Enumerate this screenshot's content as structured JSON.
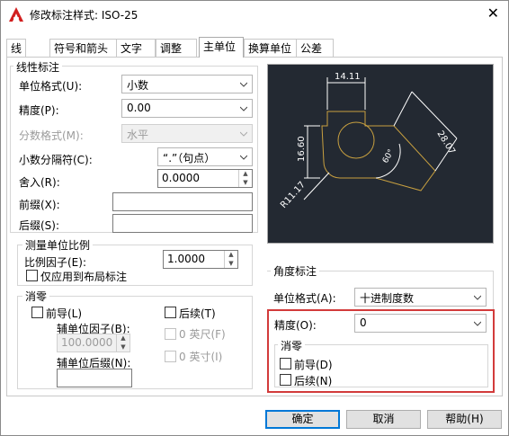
{
  "window": {
    "title": "修改标注样式: ISO-25",
    "close_glyph": "✕"
  },
  "tabs": [
    "线",
    "符号和箭头",
    "文字",
    "调整",
    "主单位",
    "换算单位",
    "公差"
  ],
  "active_tab": "主单位",
  "linear": {
    "group_label": "线性标注",
    "unit_format_label": "单位格式(U):",
    "unit_format_value": "小数",
    "precision_label": "精度(P):",
    "precision_value": "0.00",
    "fraction_format_label": "分数格式(M):",
    "fraction_format_value": "水平",
    "decimal_separator_label": "小数分隔符(C):",
    "decimal_separator_value": "“.”（句点）",
    "round_off_label": "舍入(R):",
    "round_off_value": "0.0000",
    "prefix_label": "前缀(X):",
    "prefix_value": "",
    "suffix_label": "后缀(S):",
    "suffix_value": ""
  },
  "scale": {
    "group_label": "测量单位比例",
    "scale_factor_label": "比例因子(E):",
    "scale_factor_value": "1.0000",
    "layout_only_label": "仅应用到布局标注"
  },
  "zero_suppression": {
    "group_label": "消零",
    "leading_label": "前导(L)",
    "sub_unit_factor_label": "辅单位因子(B):",
    "sub_unit_factor_value": "100.0000",
    "sub_unit_suffix_label": "辅单位后缀(N):",
    "sub_unit_suffix_value": "",
    "trailing_label": "后续(T)",
    "feet_label": "0 英尺(F)",
    "inches_label": "0 英寸(I)"
  },
  "preview": {
    "dim_top": "14.11",
    "dim_left": "16.60",
    "dim_right": "28.07",
    "dim_angle": "60°",
    "dim_radius": "R11.17",
    "line_color": "#c8a040",
    "text_color": "#ffffff"
  },
  "angular": {
    "group_label": "角度标注",
    "unit_format_label": "单位格式(A):",
    "unit_format_value": "十进制度数",
    "precision_label": "精度(O):",
    "precision_value": "0",
    "zero_group_label": "消零",
    "leading_label": "前导(D)",
    "trailing_label": "后续(N)",
    "highlight_color": "#d23b3b"
  },
  "buttons": {
    "ok": "确定",
    "cancel": "取消",
    "help": "帮助(H)"
  }
}
